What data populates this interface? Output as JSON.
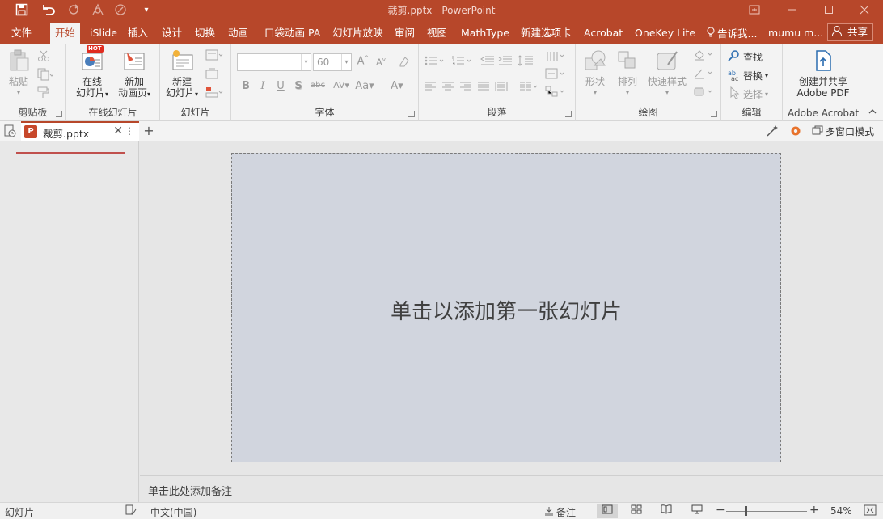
{
  "titlebar": {
    "title": "裁剪.pptx - PowerPoint",
    "qat": {
      "save_icon": "save-icon",
      "undo_icon": "undo-icon",
      "redo_icon": "redo-icon",
      "customize_icon": "customize-qat-icon"
    },
    "window_buttons": {
      "ribbon_options_icon": "ribbon-display-options-icon",
      "minimize_icon": "minimize-icon",
      "restore_icon": "restore-icon",
      "close_icon": "close-icon"
    }
  },
  "tabs": [
    {
      "label": "文件"
    },
    {
      "label": "开始"
    },
    {
      "label": "iSlide"
    },
    {
      "label": "插入"
    },
    {
      "label": "设计"
    },
    {
      "label": "切换"
    },
    {
      "label": "动画"
    },
    {
      "label": "口袋动画 PA"
    },
    {
      "label": "幻灯片放映"
    },
    {
      "label": "审阅"
    },
    {
      "label": "视图"
    },
    {
      "label": "MathType"
    },
    {
      "label": "新建选项卡"
    },
    {
      "label": "Acrobat"
    },
    {
      "label": "OneKey Lite"
    },
    {
      "label": "告诉我..."
    },
    {
      "label": "mumu m..."
    }
  ],
  "share_label": "共享",
  "ribbon": {
    "clipboard": {
      "label": "剪贴板",
      "paste": "粘贴"
    },
    "online_slides": {
      "label": "在线幻灯片",
      "online_slide_line1": "在线",
      "online_slide_line2": "幻灯片",
      "hot_badge": "HOT",
      "new_anim_line1": "新加",
      "new_anim_line2": "动画页"
    },
    "slides": {
      "label": "幻灯片",
      "new_slide_line1": "新建",
      "new_slide_line2": "幻灯片"
    },
    "font": {
      "label": "字体",
      "size_value": "60"
    },
    "paragraph": {
      "label": "段落"
    },
    "drawing": {
      "label": "绘图",
      "shapes": "形状",
      "arrange": "排列",
      "quick_styles": "快速样式"
    },
    "editing": {
      "label": "编辑",
      "find": "查找",
      "replace": "替换",
      "select": "选择"
    },
    "adobe": {
      "label": "Adobe Acrobat",
      "create_line1": "创建并共享",
      "create_line2": "Adobe PDF"
    }
  },
  "docbar": {
    "file_name": "裁剪.pptx",
    "tab_more": "⋮",
    "new_tab": "+",
    "multi_window": "多窗口模式"
  },
  "slide": {
    "placeholder": "单击以添加第一张幻灯片"
  },
  "notes": {
    "placeholder": "单击此处添加备注"
  },
  "status": {
    "slide_label": "幻灯片",
    "language": "中文(中国)",
    "notes_button": "备注",
    "zoom": "54%",
    "zoom_level": 0.54
  }
}
